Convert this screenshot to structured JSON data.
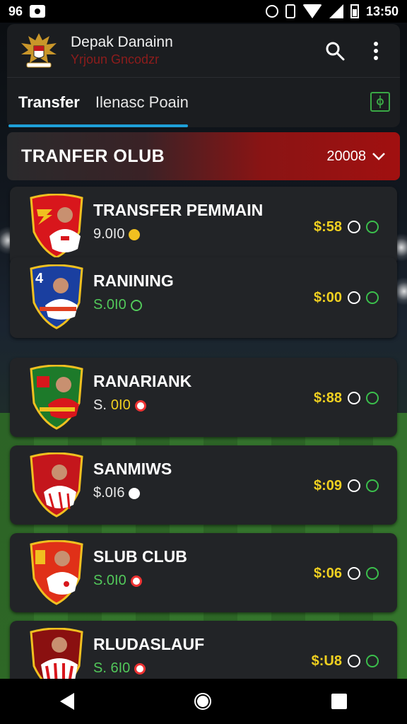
{
  "status_bar": {
    "left_text": "96",
    "time": "13:50",
    "icons": [
      "camera-icon",
      "alarm-icon",
      "vibrate-icon",
      "wifi-icon",
      "signal-icon",
      "battery-icon"
    ]
  },
  "header": {
    "title": "Depak Danainn",
    "subtitle": "Yrjoun Gncodzr",
    "search_icon": "search-icon",
    "menu_icon": "more-vert-icon"
  },
  "tabs": [
    {
      "label": "Transfer",
      "active": true
    },
    {
      "label": "Ilenasc Poain",
      "active": false
    }
  ],
  "banner": {
    "title": "TRANFER OLUB",
    "selector_value": "20008"
  },
  "players": [
    {
      "name": "TRANSFER PEMMAIN",
      "value": "9.0I0",
      "value_color": "white",
      "price": "$:58",
      "badge": "coin-icon"
    },
    {
      "name": "RANINING",
      "value": "S.0I0",
      "value_color": "green",
      "price": "$:00",
      "badge": "up-icon"
    },
    {
      "name": "RANARIANK",
      "value_prefix": "S.",
      "value": "0I0",
      "value_color": "yellow",
      "price": "$:88",
      "badge": "down-icon"
    },
    {
      "name": "SANMIWS",
      "value": "$.0I6",
      "value_color": "white",
      "price": "$:09",
      "badge": "coin-icon"
    },
    {
      "name": "SLUB CLUB",
      "value": "S.0I0",
      "value_color": "green",
      "price": "$:06",
      "badge": "down-icon"
    },
    {
      "name": "RLUDASLAUF",
      "value": "S. 6I0",
      "value_color": "green",
      "price": "$:U8",
      "badge": "down-icon"
    }
  ],
  "colors": {
    "accent_blue": "#1ea0d8",
    "banner_red": "#a11010",
    "price_yellow": "#f0d020",
    "value_green": "#52c85a"
  }
}
